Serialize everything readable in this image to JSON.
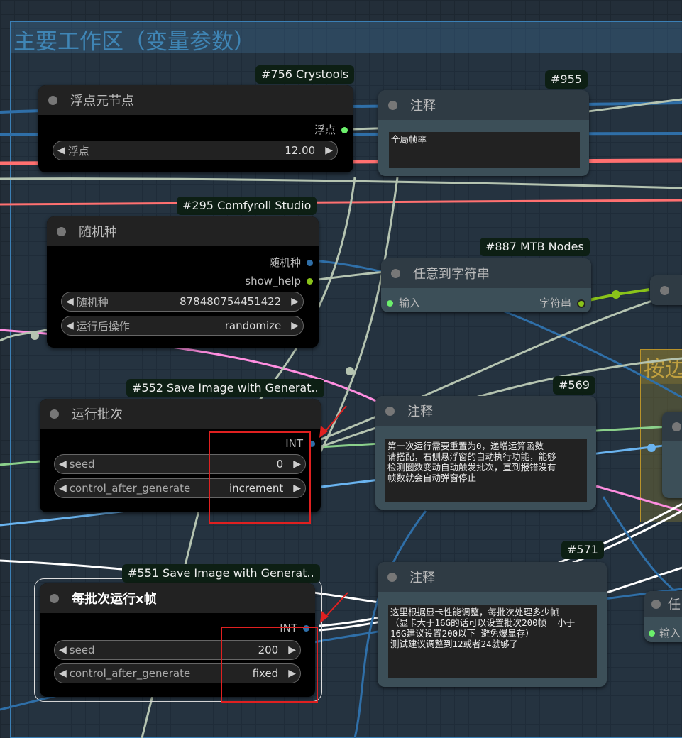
{
  "groups": {
    "main_title": "主要工作区（变量参数）",
    "right_title": "按边"
  },
  "colors": {
    "float_wire": "#b5c4b1",
    "int_wire": "#2f6fa8",
    "red_wire": "#ff7070",
    "pink_wire": "#ff8ee0",
    "green_wire": "#8bd08b",
    "string_wire": "#8ac31a",
    "accent_red": "#e02020"
  },
  "nodes": {
    "float_node": {
      "badge": "#756 Crystools",
      "title": "浮点元节点",
      "output": "浮点",
      "widget_label": "浮点",
      "widget_value": "12.00"
    },
    "note_955": {
      "badge": "#955",
      "title": "注释",
      "text": "全局帧率"
    },
    "seed_node": {
      "badge": "#295 Comfyroll Studio",
      "title": "随机种",
      "outputs": [
        "随机种",
        "show_help"
      ],
      "widgets": [
        {
          "label": "随机种",
          "value": "878480754451422"
        },
        {
          "label": "运行后操作",
          "value": "randomize"
        }
      ]
    },
    "any_to_string": {
      "badge": "#887 MTB Nodes",
      "title": "任意到字符串",
      "input": "输入",
      "output": "字符串"
    },
    "partial_right_top": {
      "title": "字"
    },
    "batch_node": {
      "badge": "#552 Save Image with Generat..",
      "title": "运行批次",
      "output": "INT",
      "widgets": [
        {
          "label": "seed",
          "value": "0"
        },
        {
          "label": "control_after_generate",
          "value": "increment"
        }
      ]
    },
    "note_569": {
      "badge": "#569",
      "title": "注释",
      "text": "第一次运行需要重置为0，递增运算函数\n请搭配，右侧悬浮窗的自动执行功能，能够\n检测圈数变动自动触发批次，直到报错没有\n帧数就会自动弹窗停止"
    },
    "frames_node": {
      "badge": "#551 Save Image with Generat..",
      "title": "每批次运行x帧",
      "output": "INT",
      "widgets": [
        {
          "label": "seed",
          "value": "200"
        },
        {
          "label": "control_after_generate",
          "value": "fixed"
        }
      ]
    },
    "note_571": {
      "badge": "#571",
      "title": "注释",
      "text": "这里根据显卡性能调整，每批次处理多少帧\n（显卡大于16G的话可以设置批次200帧  小于\n16G建议设置200以下 避免爆显存）\n测试建议调整到12或者24就够了"
    },
    "partial_right_bottom": {
      "title": "任",
      "input": "输入"
    }
  }
}
